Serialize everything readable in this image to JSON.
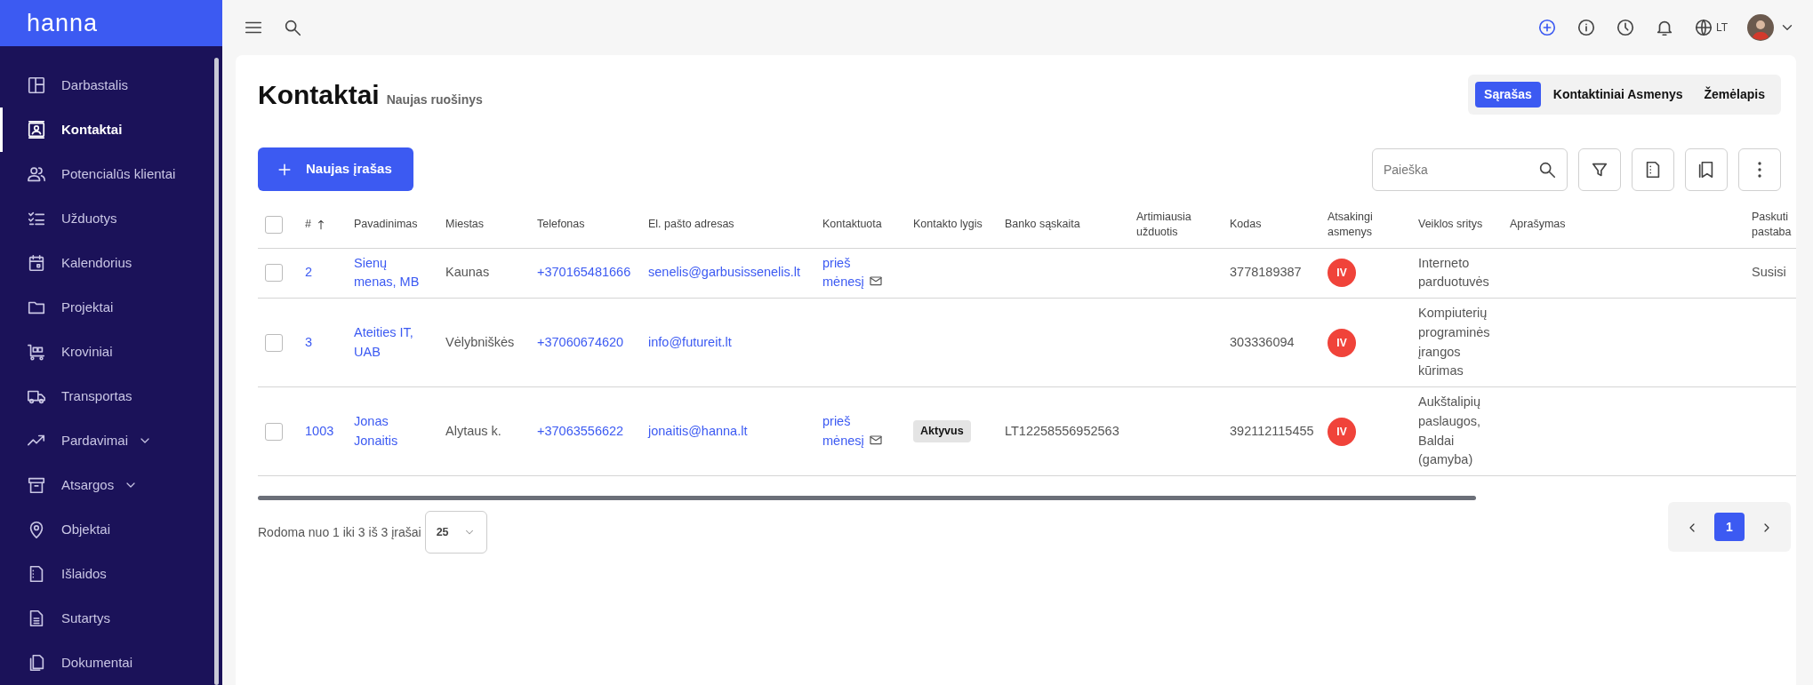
{
  "brand": "hanna",
  "sidebar": {
    "items": [
      {
        "label": "Darbastalis",
        "selected": false
      },
      {
        "label": "Kontaktai",
        "selected": true
      },
      {
        "label": "Potencialūs klientai",
        "selected": false
      },
      {
        "label": "Užduotys",
        "selected": false
      },
      {
        "label": "Kalendorius",
        "selected": false
      },
      {
        "label": "Projektai",
        "selected": false
      },
      {
        "label": "Kroviniai",
        "selected": false
      },
      {
        "label": "Transportas",
        "selected": false
      },
      {
        "label": "Pardavimai",
        "selected": false,
        "expandable": true
      },
      {
        "label": "Atsargos",
        "selected": false,
        "expandable": true
      },
      {
        "label": "Objektai",
        "selected": false
      },
      {
        "label": "Išlaidos",
        "selected": false
      },
      {
        "label": "Sutartys",
        "selected": false
      },
      {
        "label": "Dokumentai",
        "selected": false
      }
    ]
  },
  "topbar": {
    "language": "LT"
  },
  "page": {
    "title": "Kontaktai",
    "subtitle": "Naujas ruošinys",
    "view_tabs": [
      {
        "label": "Sąrašas",
        "selected": true
      },
      {
        "label": "Kontaktiniai Asmenys",
        "selected": false
      },
      {
        "label": "Žemėlapis",
        "selected": false
      }
    ],
    "new_button": "Naujas įrašas",
    "search": {
      "placeholder": "Paieška"
    }
  },
  "table": {
    "select_all": {
      "checked": false
    },
    "columns": [
      {
        "label": "#",
        "sorted": true
      },
      {
        "label": "Pavadinimas",
        "sorted": false
      },
      {
        "label": "Miestas",
        "sorted": false
      },
      {
        "label": "Telefonas",
        "sorted": false
      },
      {
        "label": "El. pašto adresas",
        "sorted": false
      },
      {
        "label": "Kontaktuota",
        "sorted": false
      },
      {
        "label": "Kontakto lygis",
        "sorted": false
      },
      {
        "label": "Banko sąskaita",
        "sorted": false
      },
      {
        "label": "Artimiausia užduotis",
        "sorted": false
      },
      {
        "label": "Kodas",
        "sorted": false
      },
      {
        "label": "Atsakingi asmenys",
        "sorted": false
      },
      {
        "label": "Veiklos sritys",
        "sorted": false
      },
      {
        "label": "Aprašymas",
        "sorted": false
      },
      {
        "label": "Paskuti pastaba",
        "sorted": false
      }
    ],
    "rows": [
      {
        "checked": false,
        "number": "2",
        "name": "Sienų menas, MB",
        "city": "Kaunas",
        "phone": "+370165481666",
        "email": "senelis@garbusissenelis.lt",
        "contacted": "prieš mėnesį",
        "code": "3778189387",
        "responsible": {
          "initials": "IV",
          "color": "#f0433a"
        },
        "activity": "Interneto parduotuvės",
        "last_note": "Susisi"
      },
      {
        "checked": false,
        "number": "3",
        "name": "Ateities IT, UAB",
        "city": "Vėlybniškės",
        "phone": "+37060674620",
        "email": "info@futureit.lt",
        "code": "303336094",
        "responsible": {
          "initials": "IV",
          "color": "#f0433a"
        },
        "activity": "Kompiuterių programinės įrangos kūrimas"
      },
      {
        "checked": false,
        "number": "1003",
        "name": "Jonas Jonaitis",
        "city": "Alytaus k.",
        "phone": "+37063556622",
        "email": "jonaitis@hanna.lt",
        "contacted": "prieš mėnesį",
        "level": "Aktyvus",
        "bank": "LT12258556952563",
        "code": "392112115455",
        "responsible": {
          "initials": "IV",
          "color": "#f0433a"
        },
        "activity": "Aukštalipių paslaugos, Baldai (gamyba)"
      }
    ]
  },
  "footer": {
    "summary": "Rodoma nuo 1 iki 3 iš 3 įrašai",
    "page_size": "25",
    "pages": [
      {
        "label": "1",
        "selected": true
      }
    ]
  }
}
